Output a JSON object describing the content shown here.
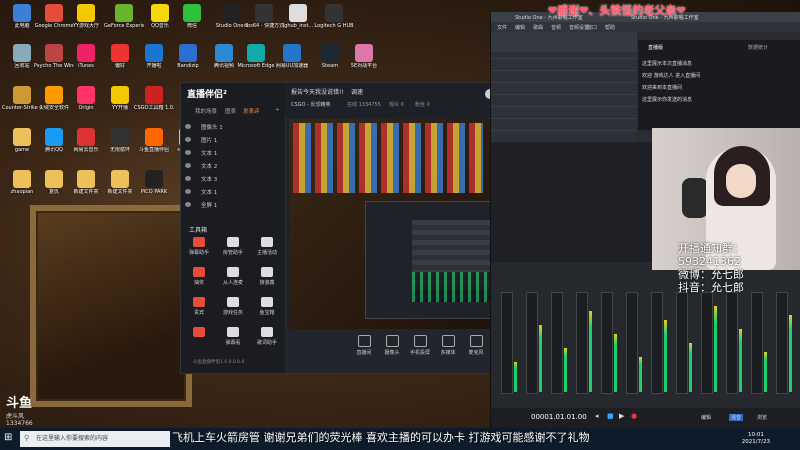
{
  "banner": "❤感谢❤、头铁怪的老父亲❤",
  "desktop_icons": [
    {
      "label": "此电脑",
      "color": "#3d7fd6"
    },
    {
      "label": "Google Chrome",
      "color": "#e44d3a"
    },
    {
      "label": "YY游戏大厅",
      "color": "#f3c800"
    },
    {
      "label": "GeForce Experience",
      "color": "#6ab42d"
    },
    {
      "label": "QQ音乐",
      "color": "#f5d90a"
    },
    {
      "label": "微信",
      "color": "#2fbf3b"
    },
    {
      "label": "Studio One 5",
      "color": "#222"
    },
    {
      "label": "obs64 - 快捷方式",
      "color": "#333"
    },
    {
      "label": "lghub_inst...",
      "color": "#ddd"
    },
    {
      "label": "Logitech G HUB",
      "color": "#333"
    },
    {
      "label": "回收站",
      "color": "#8ab"
    },
    {
      "label": "Psycho The Wine Sound",
      "color": "#b44"
    },
    {
      "label": "iTunes",
      "color": "#e26"
    },
    {
      "label": "偏好",
      "color": "#e33"
    },
    {
      "label": "开播啦",
      "color": "#1976d2"
    },
    {
      "label": "Bandizip",
      "color": "#2b6fd0"
    },
    {
      "label": "腾讯视频",
      "color": "#2a8ad6"
    },
    {
      "label": "Microsoft Edge",
      "color": "#1aa"
    },
    {
      "label": "网易UU加速器",
      "color": "#27c"
    },
    {
      "label": "Steam",
      "color": "#1b2838"
    },
    {
      "label": "5E对战平台",
      "color": "#d7a"
    },
    {
      "label": "Counter-Strike Global Off...",
      "color": "#c93"
    },
    {
      "label": "火绒安全软件",
      "color": "#f90"
    },
    {
      "label": "Origin",
      "color": "#f36"
    },
    {
      "label": "YY开播",
      "color": "#f3c800"
    },
    {
      "label": "CSGO工具箱 1.0.2 (1)",
      "color": "#c22"
    },
    {
      "label": "game",
      "color": "#eec05a"
    },
    {
      "label": "腾讯QQ",
      "color": "#1b9af2"
    },
    {
      "label": "网易云音乐",
      "color": "#d33"
    },
    {
      "label": "无限循环",
      "color": "#333"
    },
    {
      "label": "斗鱼直播伴侣",
      "color": "#f60"
    },
    {
      "label": "swwncty",
      "color": "#eec05a"
    },
    {
      "label": "zhaopian",
      "color": "#eec05a"
    },
    {
      "label": "复仇",
      "color": "#eec05a"
    },
    {
      "label": "新建文件夹",
      "color": "#eec05a"
    },
    {
      "label": "新建文件夹",
      "color": "#eec05a"
    },
    {
      "label": "PICO PARK",
      "color": "#222"
    }
  ],
  "live": {
    "logo": "直播伴侣²",
    "tabs": [
      "我的场景",
      "图表",
      "发表评",
      "+"
    ],
    "scenes": [
      "图像头 1",
      "图片 1",
      "文本 1",
      "文本 2",
      "文本 3",
      "文本 1",
      "全屏 1"
    ],
    "tools_title": "工具箱",
    "tools": [
      "弹幕助手",
      "房管助手",
      "主播活动",
      "抽奖",
      "从人连麦",
      "接滚鑫",
      "贵宾",
      "游戏任务",
      "鱼宝箱",
      "",
      "弹幕看",
      "歌词助手"
    ],
    "top_title": "报告今天我没说错!!",
    "top_tag": "调速",
    "game_label": "CSGO - 反恐精英",
    "stat_a": "在线 1334755",
    "stat_b": "观众 0",
    "stat_c": "粉丝 0",
    "bottom_buttons": [
      "直播间",
      "摄像头",
      "手机投屏",
      "多媒体",
      "麦克风",
      "扬声器"
    ],
    "footer": "斗鱼直播伴侣1.0.0.0.0.0"
  },
  "daw": {
    "title": "Studio One - 九州歌唱工作室",
    "menu": [
      "文件",
      "编辑",
      "歌曲",
      "音频",
      "音频设置",
      "窗口",
      "帮助"
    ],
    "right_title": "Studio One - 九州歌唱工作室",
    "timecode": "00001.01.01.00",
    "bottom_labels": [
      "编辑",
      "混音",
      "浏览"
    ]
  },
  "chat": {
    "tab_a": "直播版",
    "tab_b": "数据统计",
    "lines": [
      "这里展示本次直播消息",
      "欢迎 游戏达人 进入直播间",
      "欢迎来到本直播间",
      "这里展示你发送的消息"
    ],
    "welcome": "欢迎来到本直播间"
  },
  "cam_info": {
    "line1": "开播通知群：593241362",
    "line2": "微博：允七郎",
    "line3": "抖音：允七郎"
  },
  "douyu": {
    "logo": "斗鱼",
    "sub": "虎斗风",
    "num": "1334766"
  },
  "taskbar": {
    "search_placeholder": "在这里输入你要搜索的内容",
    "ticker": "飞机上车火箭房管 谢谢兄弟们的荧光棒 喜欢主播的可以办卡 打游戏可能感谢不了礼物",
    "time": "10:01",
    "date": "2021/7/23"
  },
  "colors": {
    "accent": "#ff5a6e",
    "meter": "#1cd06e",
    "taskbar": "#0d1b2a"
  }
}
